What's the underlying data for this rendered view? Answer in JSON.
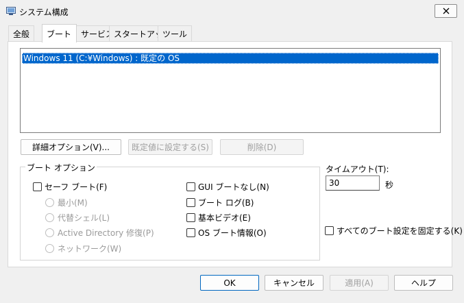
{
  "window": {
    "title": "システム構成",
    "close_glyph": "✕"
  },
  "tabs": [
    {
      "label": "全般",
      "active": false
    },
    {
      "label": "ブート",
      "active": true
    },
    {
      "label": "サービス",
      "active": false
    },
    {
      "label": "スタートアップ",
      "active": false
    },
    {
      "label": "ツール",
      "active": false
    }
  ],
  "boot_list": {
    "items": [
      "Windows 11 (C:¥Windows) : 既定の OS"
    ],
    "selected_index": 0
  },
  "list_buttons": {
    "advanced": "詳細オプション(V)...",
    "set_default": "既定値に設定する(S)",
    "delete": "削除(D)"
  },
  "boot_options": {
    "legend": "ブート オプション",
    "safe_boot": {
      "label": "セーフ ブート(F)",
      "checked": false
    },
    "radios": [
      "最小(M)",
      "代替シェル(L)",
      "Active Directory 修復(P)",
      "ネットワーク(W)"
    ],
    "no_gui": {
      "label": "GUI ブートなし(N)",
      "checked": false
    },
    "boot_log": {
      "label": "ブート ログ(B)",
      "checked": false
    },
    "base_video": {
      "label": "基本ビデオ(E)",
      "checked": false
    },
    "os_info": {
      "label": "OS ブート情報(O)",
      "checked": false
    }
  },
  "timeout": {
    "label": "タイムアウト(T):",
    "value": "30",
    "unit": "秒"
  },
  "make_permanent": {
    "label": "すべてのブート設定を固定する(K)",
    "checked": false
  },
  "footer": {
    "ok": "OK",
    "cancel": "キャンセル",
    "apply": "適用(A)",
    "help": "ヘルプ"
  },
  "colors": {
    "selection": "#0066cc",
    "ok_border": "#0067c0"
  }
}
